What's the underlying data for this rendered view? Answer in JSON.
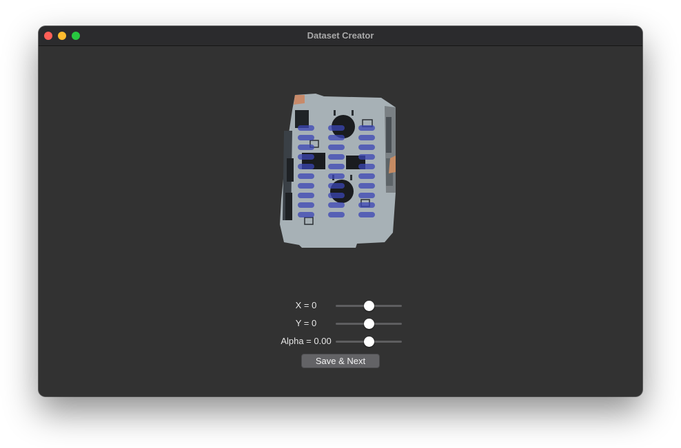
{
  "window": {
    "title": "Dataset Creator",
    "traffic_lights": {
      "close_color": "#ff5f57",
      "minimize_color": "#febc2e",
      "zoom_color": "#28c840"
    },
    "background_color": "#323232"
  },
  "image_view": {
    "content": "pcb-with-blue-overlay-image",
    "overlay_color": "#3b46b4"
  },
  "controls": {
    "x_label": "X = 0",
    "x_value_fraction": 0.5,
    "y_label": "Y = 0",
    "y_value_fraction": 0.5,
    "alpha_label": "Alpha = 0.00",
    "alpha_value_fraction": 0.5,
    "save_label": "Save & Next"
  }
}
